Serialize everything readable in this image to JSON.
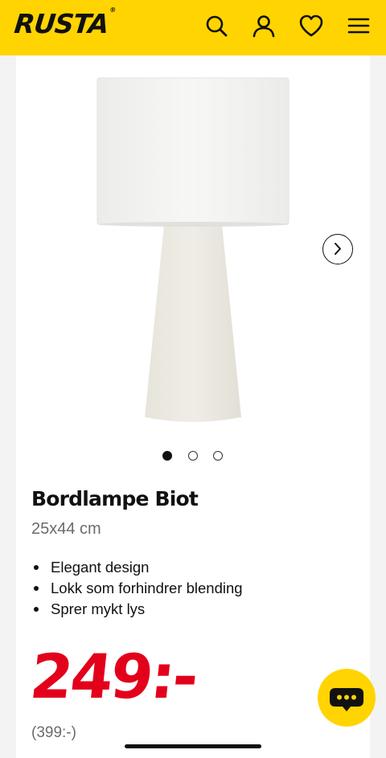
{
  "header": {
    "logo": "RUSTA",
    "logo_mark": "®",
    "icons": [
      "search-icon",
      "user-icon",
      "heart-icon",
      "menu-icon"
    ],
    "background": "#ffd400"
  },
  "product": {
    "title": "Bordlampe Biot",
    "size": "25x44 cm",
    "features": [
      "Elegant design",
      "Lokk som forhindrer blending",
      "Sprer mykt lys"
    ],
    "price": "249:-",
    "old_price": "(399:-)",
    "price_color": "#e3001b"
  },
  "gallery": {
    "image_count": 3,
    "active_index": 0,
    "next_icon": "chevron-right-icon"
  },
  "chat": {
    "icon": "chat-bubble-icon"
  }
}
